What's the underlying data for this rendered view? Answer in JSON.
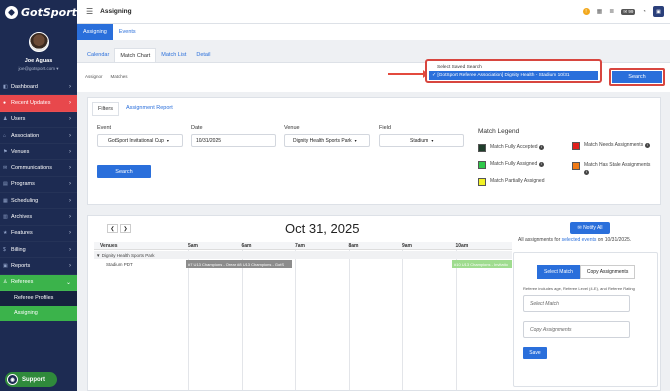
{
  "app": {
    "logo_text": "GotSport"
  },
  "profile": {
    "name": "Joe Aguas",
    "email": "joe@gotsport.com"
  },
  "sidebar": {
    "items": [
      {
        "label": "Dashboard",
        "icon": "dashboard-icon",
        "style": "normal"
      },
      {
        "label": "Recent Updates",
        "icon": "updates-icon",
        "style": "red"
      },
      {
        "label": "Users",
        "icon": "users-icon",
        "style": "normal"
      },
      {
        "label": "Association",
        "icon": "association-icon",
        "style": "normal"
      },
      {
        "label": "Venues",
        "icon": "venues-icon",
        "style": "normal"
      },
      {
        "label": "Communications",
        "icon": "communications-icon",
        "style": "normal"
      },
      {
        "label": "Programs",
        "icon": "programs-icon",
        "style": "normal"
      },
      {
        "label": "Scheduling",
        "icon": "scheduling-icon",
        "style": "normal"
      },
      {
        "label": "Archives",
        "icon": "archives-icon",
        "style": "normal"
      },
      {
        "label": "Features",
        "icon": "features-icon",
        "style": "normal"
      },
      {
        "label": "Billing",
        "icon": "billing-icon",
        "style": "normal"
      },
      {
        "label": "Reports",
        "icon": "reports-icon",
        "style": "normal"
      },
      {
        "label": "Referees",
        "icon": "referees-icon",
        "style": "green"
      }
    ],
    "subitems": [
      {
        "label": "Referee Profiles",
        "active": false
      },
      {
        "label": "Assigning",
        "active": true
      }
    ],
    "support_label": "Support"
  },
  "topbar": {
    "title": "Assigning",
    "mail_count": "99"
  },
  "main_tabs": [
    "Assigning",
    "Events"
  ],
  "sub_tabs": [
    "Calendar",
    "Match Chart",
    "Match List",
    "Detail"
  ],
  "breadcrumb": [
    "Assignor",
    "Matches"
  ],
  "saved_search": {
    "header": "Select Saved Search",
    "selected": "✓ [GotSport Referee Association] Dignity Health - Stadium 10/31"
  },
  "search_top_label": "Search",
  "filters": {
    "tabs": [
      "Filters",
      "Assignment Report"
    ],
    "event_label": "Event",
    "event_value": "GotSport Invitational Cup",
    "date_label": "Date",
    "date_value": "10/31/2025",
    "venue_label": "Venue",
    "venue_value": "Dignity Health Sports Park",
    "field_label": "Field",
    "field_value": "Stadium",
    "search_label": "Search"
  },
  "legend": {
    "title": "Match Legend",
    "items": [
      {
        "label": "Match Fully Accepted",
        "color": "#1f3d2b",
        "info": true
      },
      {
        "label": "Match Needs Assignments",
        "color": "#e0201c",
        "info": true
      },
      {
        "label": "Match Fully Assigned",
        "color": "#2fc84a",
        "info": true
      },
      {
        "label": "Match Has Stale Assignments",
        "color": "#f07a16",
        "info": true
      },
      {
        "label": "Match Partially Assigned",
        "color": "#f2f226",
        "info": false
      }
    ]
  },
  "chart": {
    "date": "Oct 31, 2025",
    "venues_header": "Venues",
    "hours": [
      "5am",
      "6am",
      "7am",
      "8am",
      "9am",
      "10am"
    ],
    "group_row": "▼ Dignity Health Sports Park",
    "venue_row": "Stadium PDT",
    "matches": [
      {
        "text": "#7 U13 Champions - Orear #8 U13 Champions - GotS",
        "color": "#8c8c8c"
      },
      {
        "text": "#10 U13 Champions - Invitatio",
        "color": "#9fdc8f"
      }
    ]
  },
  "assign": {
    "notify_label": "Notify All",
    "all_text_prefix": "All assignments for",
    "all_text_link": "selected events",
    "all_text_suffix": "on 10/31/2025.",
    "select_match_label": "Select Match",
    "copy_assignments_label": "Copy Assignments",
    "referee_note": "Referee includes age, Referee Level (4-E), and Referee Rating",
    "select_match_placeholder": "Select Match",
    "copy_assignments_placeholder": "Copy Assignments",
    "save_label": "Save"
  }
}
